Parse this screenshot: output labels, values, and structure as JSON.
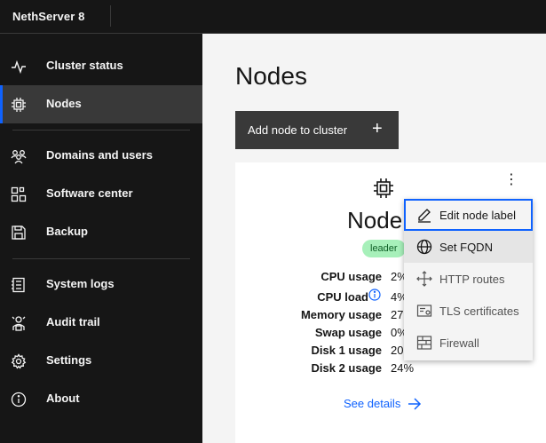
{
  "app": {
    "title": "NethServer 8"
  },
  "sidebar": {
    "items": [
      {
        "label": "Cluster status",
        "icon": "activity-icon"
      },
      {
        "label": "Nodes",
        "icon": "chip-icon",
        "active": true
      },
      {
        "label": "Domains and users",
        "icon": "users-icon"
      },
      {
        "label": "Software center",
        "icon": "apps-icon"
      },
      {
        "label": "Backup",
        "icon": "save-icon"
      },
      {
        "label": "System logs",
        "icon": "logs-icon"
      },
      {
        "label": "Audit trail",
        "icon": "audit-icon"
      },
      {
        "label": "Settings",
        "icon": "gear-icon"
      },
      {
        "label": "About",
        "icon": "info-icon"
      }
    ]
  },
  "main": {
    "title": "Nodes",
    "add_button_label": "Add node to cluster",
    "add_button_icon": "+"
  },
  "card": {
    "title": "Node",
    "badge": "leader",
    "stats": [
      {
        "label": "CPU usage",
        "value": "2%"
      },
      {
        "label": "CPU load",
        "value": "4%"
      },
      {
        "label": "Memory usage",
        "value": "27"
      },
      {
        "label": "Swap usage",
        "value": "0%"
      },
      {
        "label": "Disk 1 usage",
        "value": "20"
      },
      {
        "label": "Disk 2 usage",
        "value": "24%"
      }
    ],
    "see_details": "See details",
    "kebab": "⋮"
  },
  "menu": {
    "items": [
      {
        "label": "Edit node label",
        "icon": "edit-icon"
      },
      {
        "label": "Set FQDN",
        "icon": "globe-icon"
      },
      {
        "label": "HTTP routes",
        "icon": "routes-icon"
      },
      {
        "label": "TLS certificates",
        "icon": "certificate-icon"
      },
      {
        "label": "Firewall",
        "icon": "firewall-icon"
      }
    ]
  },
  "colors": {
    "sidebar_bg": "#161616",
    "active_bg": "#393939",
    "accent": "#0f62fe",
    "badge_bg": "#a7f0ba",
    "badge_text": "#0e6027"
  }
}
